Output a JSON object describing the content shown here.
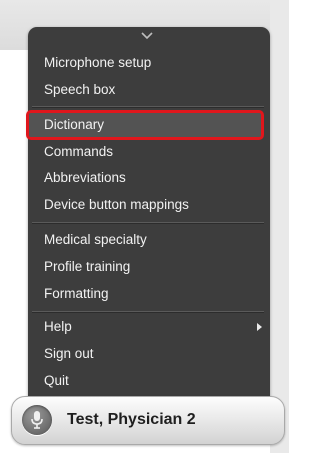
{
  "menu": {
    "groups": [
      {
        "items": [
          {
            "label": "Microphone setup"
          },
          {
            "label": "Speech box"
          }
        ]
      },
      {
        "items": [
          {
            "label": "Dictionary",
            "selected": true,
            "highlight_color": "#e0161c"
          },
          {
            "label": "Commands"
          },
          {
            "label": "Abbreviations"
          },
          {
            "label": "Device button mappings"
          }
        ]
      },
      {
        "items": [
          {
            "label": "Medical specialty"
          },
          {
            "label": "Profile training"
          },
          {
            "label": "Formatting"
          }
        ]
      },
      {
        "items": [
          {
            "label": "Help",
            "has_submenu": true
          },
          {
            "label": "Sign out"
          },
          {
            "label": "Quit"
          }
        ]
      }
    ],
    "collapse_icon": "chevron-down-icon",
    "submenu_icon": "chevron-right-icon"
  },
  "user_bar": {
    "name": "Test, Physician 2",
    "icon": "microphone-icon"
  },
  "colors": {
    "menu_background": "#3d3d3d",
    "menu_text": "#f2f2f2",
    "selection_border": "#e0161c"
  }
}
